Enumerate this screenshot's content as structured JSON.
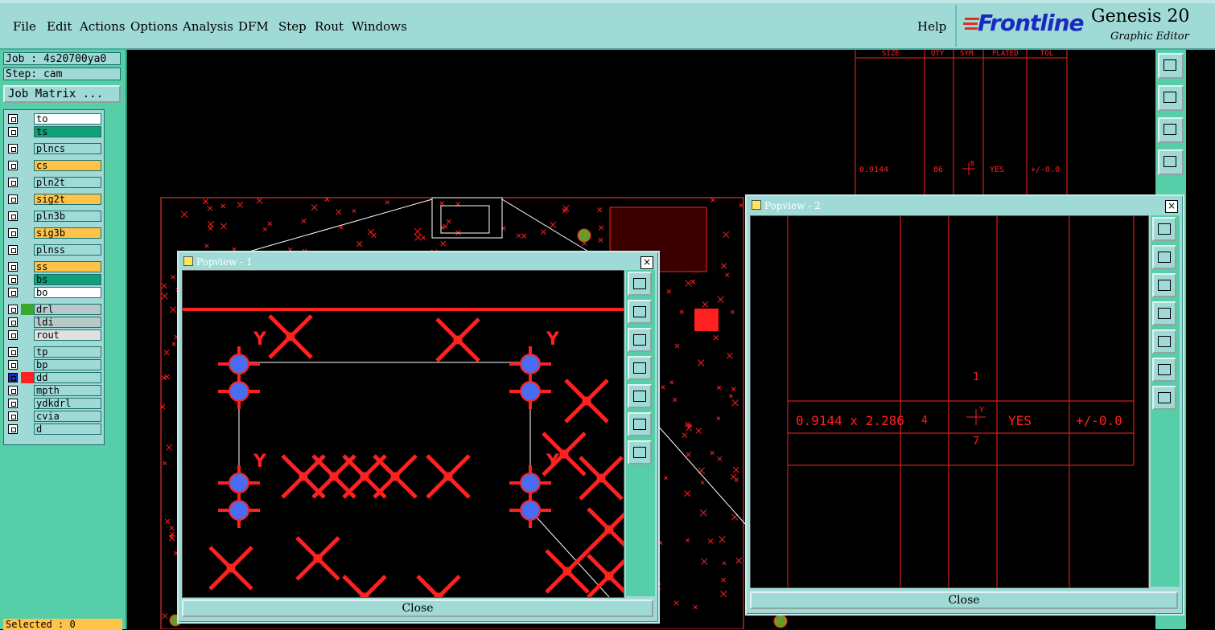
{
  "menu": {
    "items": [
      "File",
      "Edit",
      "Actions",
      "Options",
      "Analysis",
      "DFM",
      "Step",
      "Rout",
      "Windows"
    ],
    "help": "Help"
  },
  "brand": {
    "logo": "Frontline",
    "product": "Genesis 20",
    "subtitle": "Graphic Editor",
    "logo_color": "#1a2ac0"
  },
  "job": {
    "job_label": "Job : 4s20700ya0",
    "step_label": "Step: cam",
    "matrix_button": "Job Matrix ..."
  },
  "layers": [
    {
      "name": "to",
      "color": "#ffffff"
    },
    {
      "name": "ts",
      "color": "#12a07a"
    },
    {
      "name": "plncs",
      "color": "#9fdad7"
    },
    {
      "name": "cs",
      "color": "#ffc34a"
    },
    {
      "name": "pln2t",
      "color": "#9fdad7"
    },
    {
      "name": "sig2t",
      "color": "#ffc34a"
    },
    {
      "name": "pln3b",
      "color": "#9fdad7"
    },
    {
      "name": "sig3b",
      "color": "#ffc34a"
    },
    {
      "name": "plnss",
      "color": "#9fdad7"
    },
    {
      "name": "ss",
      "color": "#ffc34a"
    },
    {
      "name": "bs",
      "color": "#12a07a"
    },
    {
      "name": "bo",
      "color": "#ffffff"
    },
    {
      "name": "drl",
      "color": "#b7c9c9"
    },
    {
      "name": "ldi",
      "color": "#b7c9c9"
    },
    {
      "name": "rout",
      "color": "#e0e0e0"
    },
    {
      "name": "tp",
      "color": "#9fdad7"
    },
    {
      "name": "bp",
      "color": "#9fdad7"
    },
    {
      "name": "dd",
      "color": "#9fdad7"
    },
    {
      "name": "mpth",
      "color": "#9fdad7"
    },
    {
      "name": "ydkdrl",
      "color": "#9fdad7"
    },
    {
      "name": "cvia",
      "color": "#9fdad7"
    },
    {
      "name": "d",
      "color": "#9fdad7"
    }
  ],
  "status": {
    "selected": "Selected : 0"
  },
  "drill_table": {
    "headers": [
      "SIZE",
      "QTY",
      "SYM",
      "PLATED",
      "TOL"
    ],
    "row": {
      "size": "0.9144",
      "qty": "86",
      "sym": "B",
      "plated": "YES",
      "tol": "+/-0.0"
    }
  },
  "popview1": {
    "title": "Popview - 1",
    "close_label": "Close"
  },
  "popview2": {
    "title": "Popview - 2",
    "close_label": "Close",
    "cell_top": "1",
    "size": "0.9144 x 2.286",
    "qty": "4",
    "sym": "Y",
    "plated": "YES",
    "tol": "+/-0.0",
    "cell_bottom": "7"
  },
  "colors": {
    "panel_teal": "#56cfa8",
    "widget_light": "#9fdad7",
    "drawing_red": "#ff2020",
    "pad_blue": "#4a6cf0",
    "highlight_orange": "#ffc34a"
  }
}
